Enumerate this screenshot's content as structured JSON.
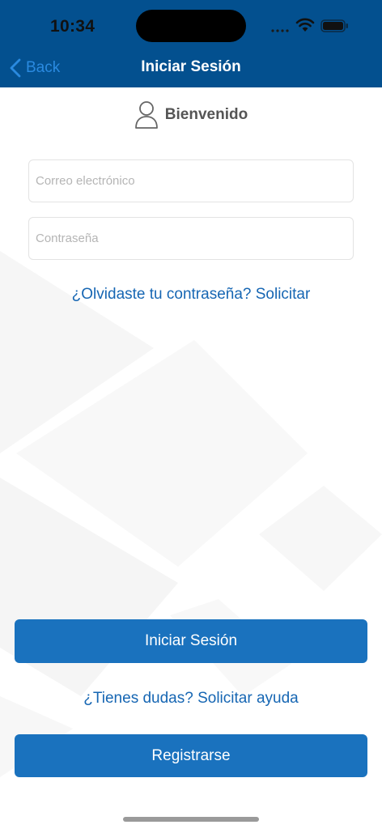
{
  "status_bar": {
    "time": "10:34"
  },
  "nav": {
    "back_label": "Back",
    "title": "Iniciar Sesión"
  },
  "welcome": {
    "text": "Bienvenido",
    "icon": "user-icon"
  },
  "form": {
    "email_placeholder": "Correo electrónico",
    "email_value": "",
    "password_placeholder": "Contraseña",
    "password_value": ""
  },
  "links": {
    "forgot_password": "¿Olvidaste tu contraseña? Solicitar",
    "help": "¿Tienes dudas? Solicitar ayuda"
  },
  "buttons": {
    "login": "Iniciar Sesión",
    "register": "Registrarse"
  },
  "colors": {
    "header_bg": "#03508f",
    "primary_button": "#1a72be",
    "link": "#1666b3",
    "back": "#2a8ae0"
  }
}
